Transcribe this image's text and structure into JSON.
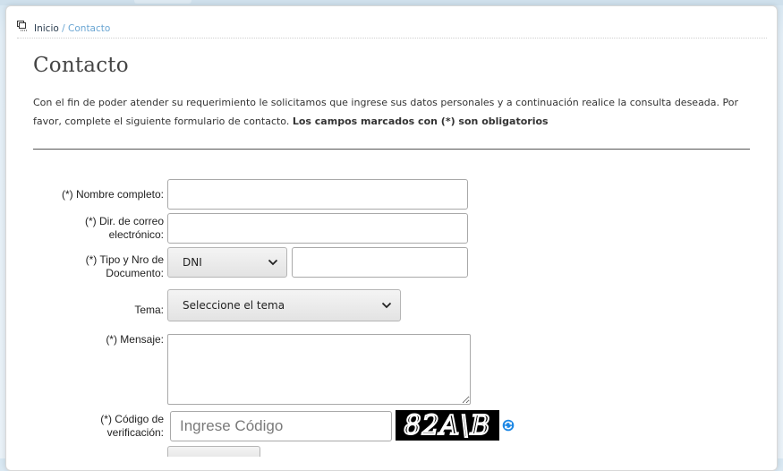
{
  "breadcrumb": {
    "home": "Inicio",
    "separator": "/",
    "current": "Contacto"
  },
  "page": {
    "title": "Contacto",
    "intro": "Con el fin de poder atender su requerimiento le solicitamos que ingrese sus datos personales y a continuación realice la consulta deseada. Por favor, complete el siguiente formulario de contacto.",
    "intro_bold": "Los campos marcados con (*) son obligatorios"
  },
  "form": {
    "name_label": "(*) Nombre completo:",
    "name_value": "",
    "email_label_line1": "(*) Dir. de correo",
    "email_label_line2": "electrónico:",
    "email_value": "",
    "doc_label_line1": "(*) Tipo y Nro de",
    "doc_label_line2": "Documento:",
    "doc_type_selected": "DNI",
    "doc_number_value": "",
    "topic_label": "Tema:",
    "topic_selected": "Seleccione el tema",
    "message_label": "(*) Mensaje:",
    "message_value": "",
    "code_label_line1": "(*) Código de",
    "code_label_line2": "verificación:",
    "code_placeholder": "Ingrese Código",
    "captcha_text": "82A\\B"
  },
  "icons": {
    "breadcrumb": "breadcrumb-icon",
    "select_arrow": "chevron-down-icon",
    "refresh": "refresh-icon"
  },
  "colors": {
    "link_current": "#6aa6d3",
    "refresh": "#1e88e5"
  }
}
